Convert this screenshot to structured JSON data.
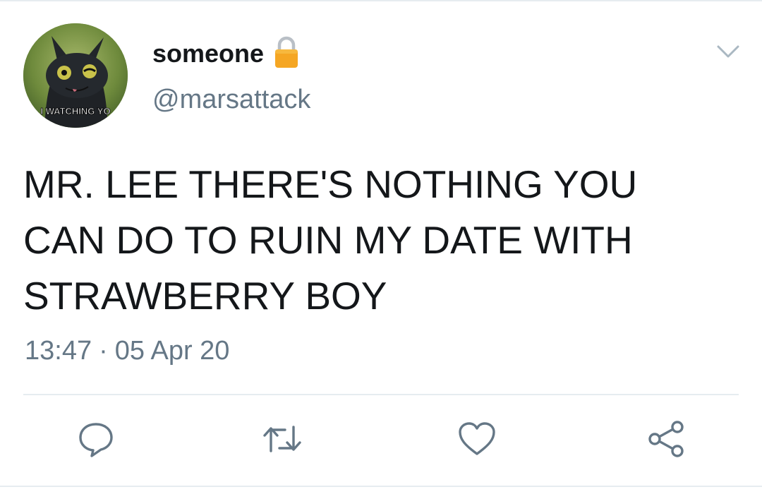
{
  "tweet": {
    "display_name": "someone",
    "handle": "@marsattack",
    "avatar_caption": "I WATCHING YO",
    "text": "MR. LEE THERE'S NOTHING YOU\nCAN DO TO RUIN MY DATE WITH\nSTRAWBERRY BOY",
    "time": "13:47",
    "separator": "·",
    "date": "05 Apr 20",
    "protected_icon": "lock-icon"
  },
  "actions": [
    {
      "name": "reply",
      "icon": "comment-icon"
    },
    {
      "name": "retweet",
      "icon": "retweet-icon"
    },
    {
      "name": "like",
      "icon": "heart-icon"
    },
    {
      "name": "share",
      "icon": "share-icon"
    }
  ],
  "colors": {
    "text_primary": "#14171a",
    "text_secondary": "#657786",
    "icon": "#657786",
    "divider": "#e6ecf0",
    "lock": "#f5a623"
  }
}
